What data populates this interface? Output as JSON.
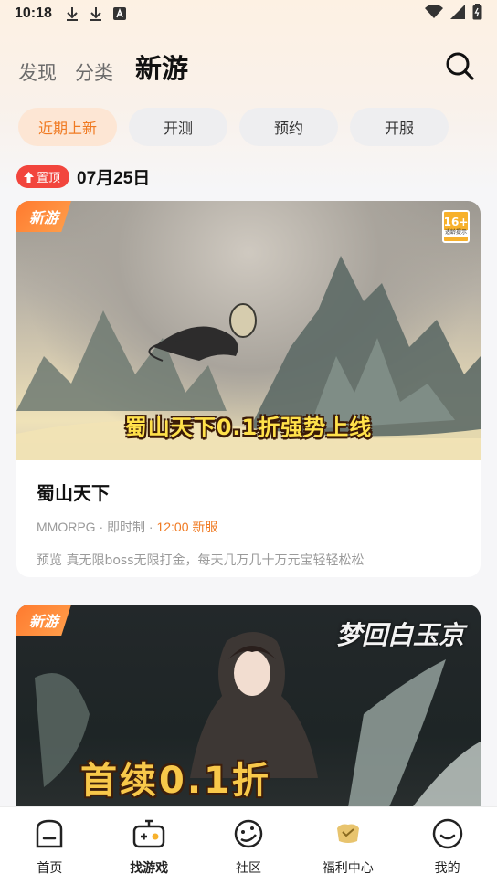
{
  "status_bar": {
    "time": "10:18"
  },
  "header": {
    "tabs": [
      {
        "label": "发现",
        "active": false
      },
      {
        "label": "分类",
        "active": false
      },
      {
        "label": "新游",
        "active": true
      }
    ]
  },
  "filter_chips": [
    {
      "label": "近期上新",
      "active": true
    },
    {
      "label": "开测",
      "active": false
    },
    {
      "label": "预约",
      "active": false
    },
    {
      "label": "开服",
      "active": false
    }
  ],
  "section": {
    "pin_label": "置顶",
    "date": "07月25日"
  },
  "games": [
    {
      "tag": "新游",
      "age_rating": "16+",
      "age_rating_sub": "适龄提示",
      "banner_slogan": "蜀山天下0.1折强势上线",
      "name": "蜀山天下",
      "genre": "MMORPG",
      "mode": "即时制",
      "server_time": "12:00 新服",
      "description": "预览 真无限boss无限打金，每天几万几十万元宝轻轻松松"
    },
    {
      "tag": "新游",
      "logo_text": "梦回白玉京",
      "banner_slogan": "首续0.1折"
    }
  ],
  "bottom_nav": [
    {
      "label": "首页",
      "icon": "home-icon",
      "active": false
    },
    {
      "label": "找游戏",
      "icon": "gamepad-icon",
      "active": true
    },
    {
      "label": "社区",
      "icon": "community-icon",
      "active": false
    },
    {
      "label": "福利中心",
      "icon": "gift-icon",
      "active": false
    },
    {
      "label": "我的",
      "icon": "profile-icon",
      "active": false
    }
  ],
  "colors": {
    "accent": "#f07a22",
    "pin_red": "#f2453d",
    "chip_active_bg": "#fde6d4"
  }
}
